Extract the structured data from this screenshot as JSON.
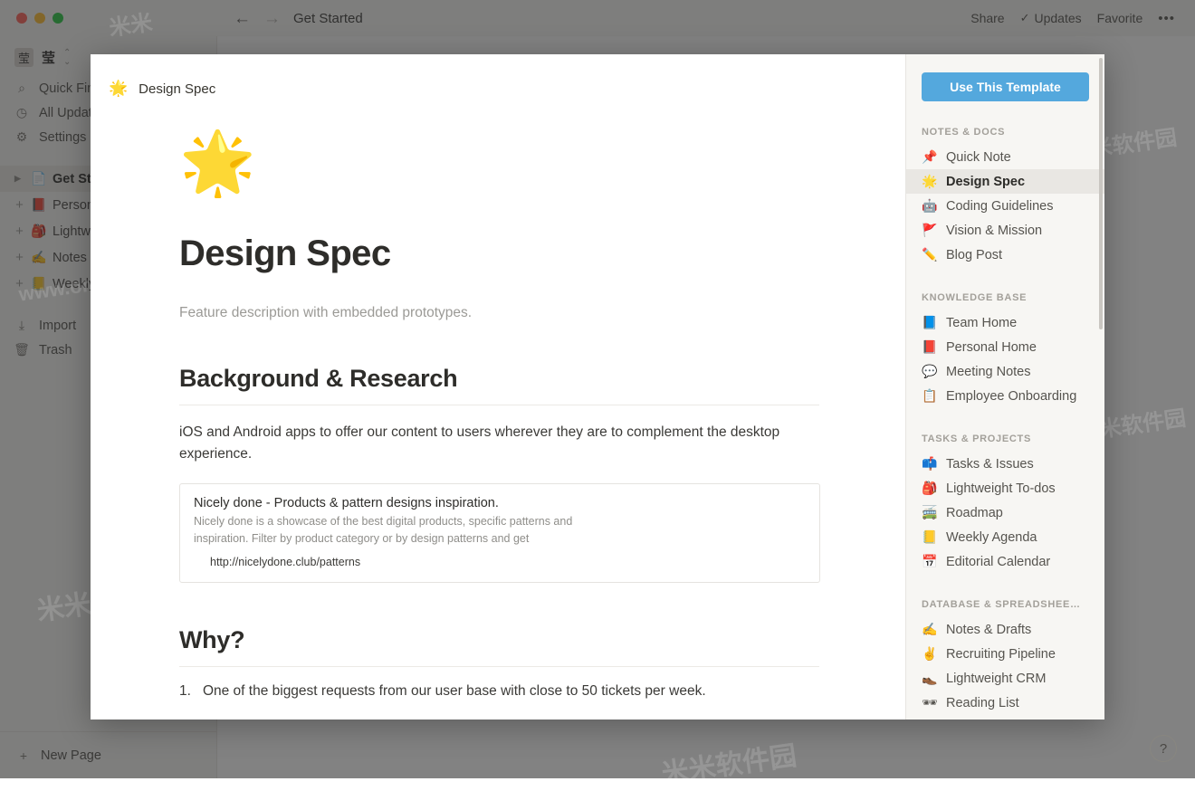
{
  "window": {
    "traffic_lights": [
      "close",
      "minimize",
      "maximize"
    ],
    "nav_back": "←",
    "nav_forward": "→",
    "breadcrumb_title": "Get Started",
    "actions": [
      {
        "label": "Share",
        "icon": ""
      },
      {
        "label": "Updates",
        "icon": "✓"
      },
      {
        "label": "Favorite",
        "icon": ""
      },
      {
        "label": "•••",
        "icon": ""
      }
    ],
    "share_label": "Share",
    "updates_label": "Updates",
    "updates_check": "✓",
    "favorite_label": "Favorite",
    "more_label": "•••"
  },
  "sidebar": {
    "user": {
      "avatar_glyph": "莹",
      "name": "莹",
      "chevrons": "⌃⌄"
    },
    "nav_items": [
      {
        "label": "Quick Find",
        "icon": "search-icon",
        "glyph": "⌕"
      },
      {
        "label": "All Updates",
        "icon": "clock-icon",
        "glyph": "◷"
      },
      {
        "label": "Settings",
        "icon": "gear-icon",
        "glyph": "⚙"
      }
    ],
    "pages": [
      {
        "label": "Get Started",
        "emoji": "📄",
        "selected": true,
        "expander": "▶"
      },
      {
        "label": "Personal Home",
        "emoji": "📕",
        "selected": false,
        "expander": "+"
      },
      {
        "label": "Lightweight To-dos",
        "emoji": "🎒",
        "selected": false,
        "expander": "+"
      },
      {
        "label": "Notes & Drafts",
        "emoji": "✍️",
        "selected": false,
        "expander": "+"
      },
      {
        "label": "Weekly Agenda",
        "emoji": "📒",
        "selected": false,
        "expander": "+"
      }
    ],
    "utility_items": [
      {
        "label": "Import",
        "icon": "download-icon",
        "glyph": "⤓"
      },
      {
        "label": "Trash",
        "icon": "trash-icon",
        "glyph": "🗑"
      }
    ],
    "footer": {
      "label": "New Page",
      "icon": "plus-icon",
      "glyph": "+"
    }
  },
  "modal": {
    "header": {
      "emoji": "🌟",
      "title": "Design Spec"
    },
    "document": {
      "hero_emoji": "🌟",
      "title": "Design Spec",
      "subtitle": "Feature description with embedded prototypes.",
      "section1_heading": "Background & Research",
      "section1_paragraph": "iOS and Android apps to offer our content to users wherever they are to complement the desktop experience.",
      "bookmark": {
        "title": "Nicely done - Products & pattern designs inspiration.",
        "description": "Nicely done is a showcase of the best digital products, specific patterns and inspiration. Filter by product category or by design patterns and get",
        "url": "http://nicelydone.club/patterns"
      },
      "section2_heading": "Why?",
      "list_item_1_num": "1.",
      "list_item_1_text": "One of the biggest requests from our user base with close to 50 tickets per week."
    },
    "template_panel": {
      "use_template_label": "Use This Template",
      "accent_color": "#54a8dd",
      "groups": [
        {
          "label": "NOTES & DOCS",
          "items": [
            {
              "label": "Quick Note",
              "emoji": "📌",
              "active": false
            },
            {
              "label": "Design Spec",
              "emoji": "🌟",
              "active": true
            },
            {
              "label": "Coding Guidelines",
              "emoji": "🤖",
              "active": false
            },
            {
              "label": "Vision & Mission",
              "emoji": "🚩",
              "active": false
            },
            {
              "label": "Blog Post",
              "emoji": "✏️",
              "active": false
            }
          ]
        },
        {
          "label": "KNOWLEDGE BASE",
          "items": [
            {
              "label": "Team Home",
              "emoji": "📘",
              "active": false
            },
            {
              "label": "Personal Home",
              "emoji": "📕",
              "active": false
            },
            {
              "label": "Meeting Notes",
              "emoji": "💬",
              "active": false
            },
            {
              "label": "Employee Onboarding",
              "emoji": "📋",
              "active": false
            }
          ]
        },
        {
          "label": "TASKS & PROJECTS",
          "items": [
            {
              "label": "Tasks & Issues",
              "emoji": "📫",
              "active": false
            },
            {
              "label": "Lightweight To-dos",
              "emoji": "🎒",
              "active": false
            },
            {
              "label": "Roadmap",
              "emoji": "🚎",
              "active": false
            },
            {
              "label": "Weekly Agenda",
              "emoji": "📒",
              "active": false
            },
            {
              "label": "Editorial Calendar",
              "emoji": "📅",
              "active": false
            }
          ]
        },
        {
          "label": "DATABASE & SPREADSHEE…",
          "items": [
            {
              "label": "Notes & Drafts",
              "emoji": "✍️",
              "active": false
            },
            {
              "label": "Recruiting Pipeline",
              "emoji": "✌️",
              "active": false
            },
            {
              "label": "Lightweight CRM",
              "emoji": "👞",
              "active": false
            },
            {
              "label": "Reading List",
              "emoji": "🕶",
              "active": false
            }
          ]
        }
      ]
    }
  },
  "help": {
    "glyph": "?"
  },
  "watermarks": [
    "米米软件园",
    "www.orsoon.com"
  ]
}
